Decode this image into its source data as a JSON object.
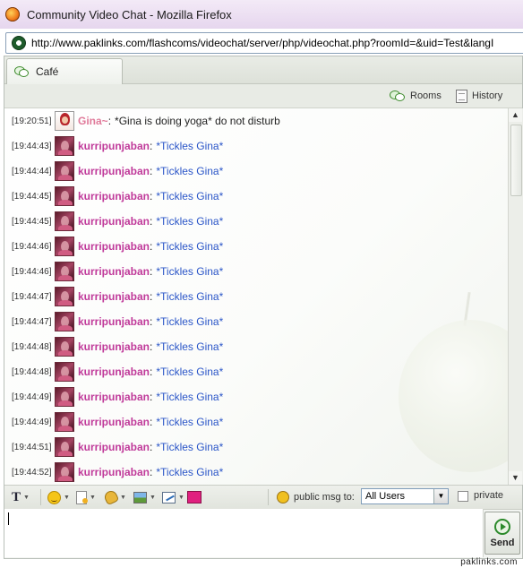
{
  "window": {
    "title": "Community Video Chat - Mozilla Firefox"
  },
  "browser": {
    "url": "http://www.paklinks.com/flashcoms/videochat/server/php/videochat.php?roomId=&uid=Test&langI"
  },
  "chat": {
    "tab_label": "Café",
    "toolbar": {
      "rooms_label": "Rooms",
      "history_label": "History"
    },
    "messages": [
      {
        "time": "[19:20:51]",
        "user": "Gina~",
        "text": "*Gina is doing yoga* do not disturb"
      },
      {
        "time": "[19:44:43]",
        "user": "kurripunjaban",
        "text": "*Tickles Gina*"
      },
      {
        "time": "[19:44:44]",
        "user": "kurripunjaban",
        "text": "*Tickles Gina*"
      },
      {
        "time": "[19:44:45]",
        "user": "kurripunjaban",
        "text": "*Tickles Gina*"
      },
      {
        "time": "[19:44:45]",
        "user": "kurripunjaban",
        "text": "*Tickles Gina*"
      },
      {
        "time": "[19:44:46]",
        "user": "kurripunjaban",
        "text": "*Tickles Gina*"
      },
      {
        "time": "[19:44:46]",
        "user": "kurripunjaban",
        "text": "*Tickles Gina*"
      },
      {
        "time": "[19:44:47]",
        "user": "kurripunjaban",
        "text": "*Tickles Gina*"
      },
      {
        "time": "[19:44:47]",
        "user": "kurripunjaban",
        "text": "*Tickles Gina*"
      },
      {
        "time": "[19:44:48]",
        "user": "kurripunjaban",
        "text": "*Tickles Gina*"
      },
      {
        "time": "[19:44:48]",
        "user": "kurripunjaban",
        "text": "*Tickles Gina*"
      },
      {
        "time": "[19:44:49]",
        "user": "kurripunjaban",
        "text": "*Tickles Gina*"
      },
      {
        "time": "[19:44:49]",
        "user": "kurripunjaban",
        "text": "*Tickles Gina*"
      },
      {
        "time": "[19:44:51]",
        "user": "kurripunjaban",
        "text": "*Tickles Gina*"
      },
      {
        "time": "[19:44:52]",
        "user": "kurripunjaban",
        "text": "*Tickles Gina*"
      }
    ],
    "separator": ":",
    "format_bar": {
      "text_icon": "T",
      "public_msg_label": "public msg to:",
      "recipient_selected": "All Users",
      "private_label": "private"
    },
    "input": {
      "value": ""
    },
    "send_label": "Send"
  },
  "watermark": "paklinks.com",
  "icons": {
    "browser": "firefox-icon",
    "site": "globe-icon",
    "tab": "chat-bubbles-icon",
    "rooms": "chat-bubbles-icon",
    "history": "document-icon",
    "send": "arrow-circle-icon"
  },
  "colors": {
    "gina_name": "#e07a9a",
    "kurri_name": "#c03a9a",
    "kurri_text": "#2b56c8"
  }
}
